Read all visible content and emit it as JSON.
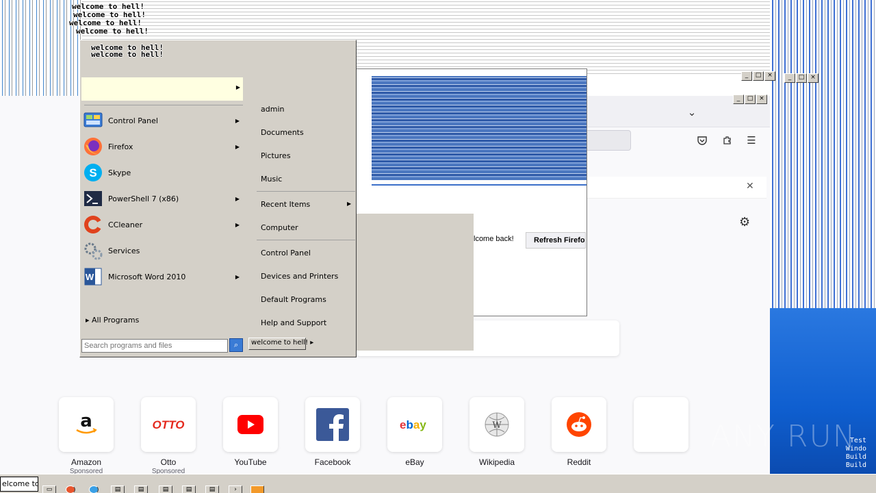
{
  "start_menu": {
    "welcome_lines": [
      "welcome to hell!",
      "welcome to hell!",
      "welcome to hell!",
      "welcome to hell!",
      "welcome to hell!",
      "welcome to hell!"
    ],
    "pinned": [
      {
        "label": "Control Panel",
        "icon": "control-panel-icon",
        "has_submenu": true
      },
      {
        "label": "Firefox",
        "icon": "firefox-icon",
        "has_submenu": true
      },
      {
        "label": "Skype",
        "icon": "skype-icon",
        "has_submenu": false
      },
      {
        "label": "PowerShell 7 (x86)",
        "icon": "powershell-icon",
        "has_submenu": true
      },
      {
        "label": "CCleaner",
        "icon": "ccleaner-icon",
        "has_submenu": true
      },
      {
        "label": "Services",
        "icon": "services-gear-icon",
        "has_submenu": false
      },
      {
        "label": "Microsoft Word 2010",
        "icon": "word-icon",
        "has_submenu": true
      }
    ],
    "all_programs": "All Programs",
    "search_placeholder": "Search programs and files",
    "right_items": [
      "admin",
      "Documents",
      "Pictures",
      "Music",
      "Recent Items",
      "Computer",
      "Control Panel",
      "Devices and Printers",
      "Default Programs",
      "Help and Support"
    ],
    "shutdown_label": "welcome to hell!"
  },
  "browser": {
    "welcome_back": "lcome back!",
    "refresh_label": "Refresh Firefox",
    "shortcuts": [
      {
        "label": "Amazon",
        "sub": "Sponsored",
        "icon": "amazon-logo"
      },
      {
        "label": "Otto",
        "sub": "Sponsored",
        "icon": "otto-logo"
      },
      {
        "label": "YouTube",
        "sub": "",
        "icon": "youtube-logo"
      },
      {
        "label": "Facebook",
        "sub": "",
        "icon": "facebook-logo"
      },
      {
        "label": "eBay",
        "sub": "",
        "icon": "ebay-logo"
      },
      {
        "label": "Wikipedia",
        "sub": "",
        "icon": "wikipedia-logo"
      },
      {
        "label": "Reddit",
        "sub": "",
        "icon": "reddit-logo"
      },
      {
        "label": "",
        "sub": "",
        "icon": "empty-tile"
      }
    ]
  },
  "taskbar": {
    "start_label": "elcome to"
  },
  "watermark": {
    "brand": "ANY RUN",
    "lines": [
      "Test",
      "Windo",
      "Build",
      "Build"
    ]
  },
  "colors": {
    "classic_gray": "#d4d0c8",
    "desktop_blue": "#1a66d6",
    "highlight_yellow": "#ffffe1"
  }
}
